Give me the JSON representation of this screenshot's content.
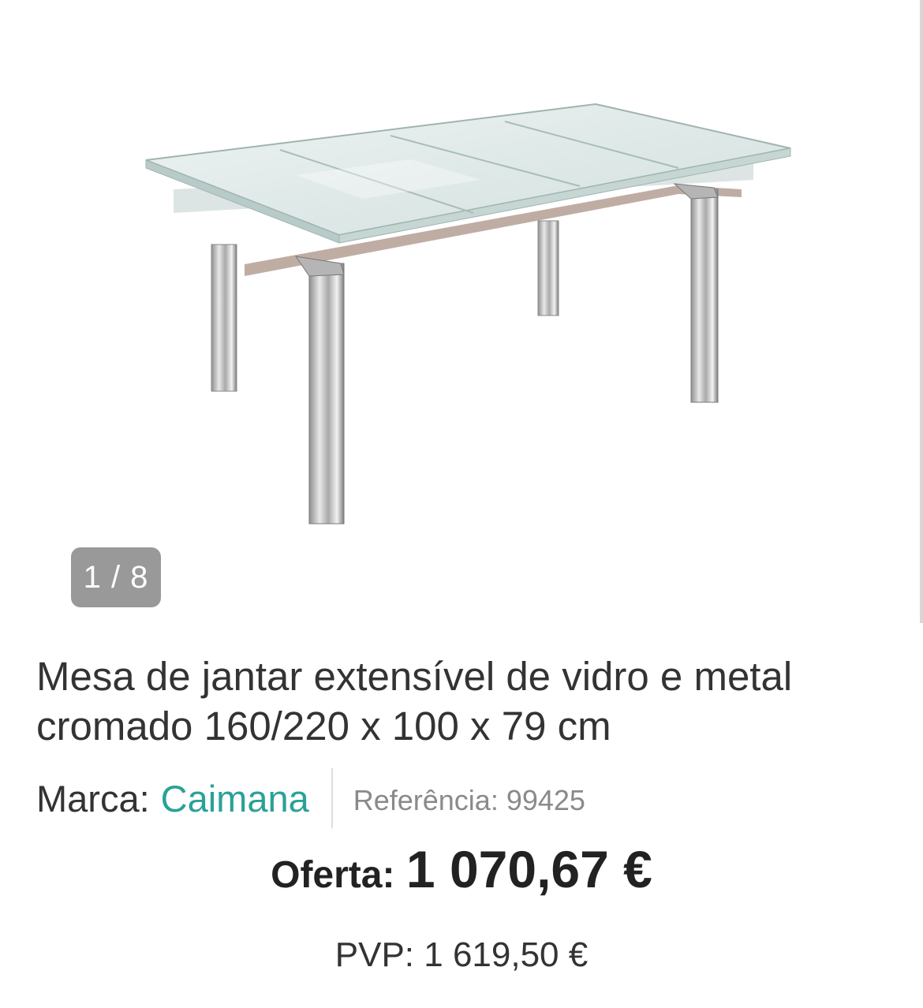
{
  "gallery": {
    "counter": "1 / 8",
    "image_alt": "Mesa de jantar extensível de vidro e metal cromado"
  },
  "product": {
    "title": "Mesa de jantar extensível de vidro e metal cromado 160/220 x 100 x 79 cm",
    "brand_label": "Marca:",
    "brand_name": "Caimana",
    "reference": "Referência: 99425"
  },
  "pricing": {
    "offer_label": "Oferta:",
    "offer_price": "1 070,67 €",
    "pvp": "PVP: 1 619,50 €"
  },
  "colors": {
    "brand_link": "#2aa198",
    "counter_bg": "#999999"
  }
}
